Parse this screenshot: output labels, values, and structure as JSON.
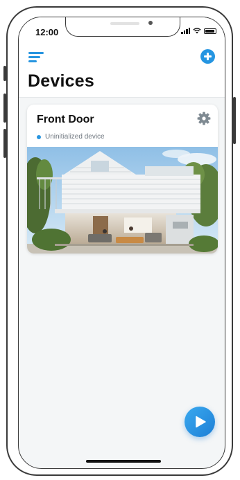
{
  "status_bar": {
    "time": "12:00"
  },
  "header": {
    "title": "Devices"
  },
  "devices": [
    {
      "name": "Front Door",
      "status": "Uninitialized device",
      "status_color": "#2a96e0"
    }
  ],
  "colors": {
    "accent": "#2595e1",
    "background": "#f4f6f7"
  },
  "icons": [
    "menu-icon",
    "add-icon",
    "gear-icon",
    "play-icon",
    "signal-icon",
    "wifi-icon",
    "battery-icon"
  ]
}
